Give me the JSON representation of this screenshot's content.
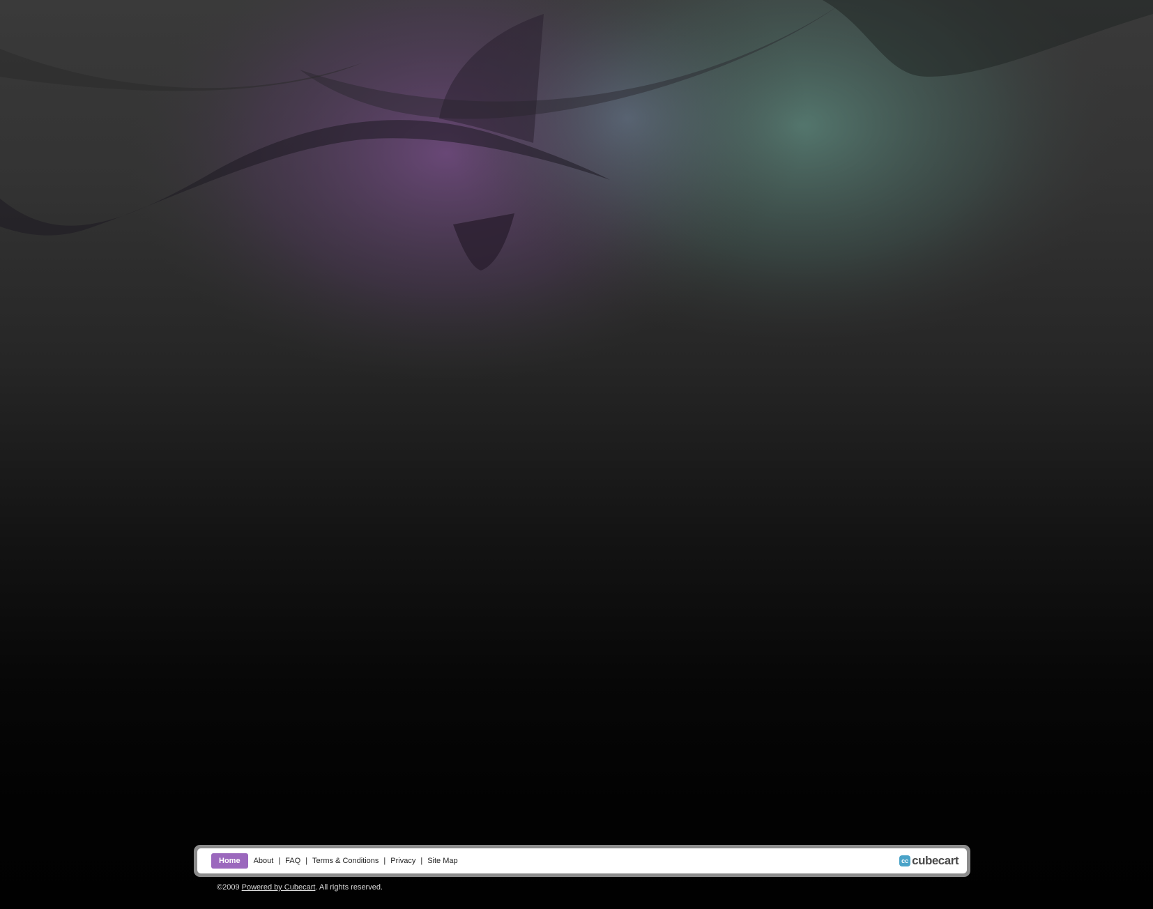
{
  "footer": {
    "nav": [
      {
        "label": "Home",
        "active": true
      },
      {
        "label": "About"
      },
      {
        "label": "FAQ"
      },
      {
        "label": "Terms & Conditions"
      },
      {
        "label": "Privacy"
      },
      {
        "label": "Site Map"
      }
    ],
    "separator": "|",
    "logo_mark": "cc",
    "logo_text": "cubecart"
  },
  "copyright": {
    "prefix": "©2009 ",
    "link_text": "Powered by Cubecart",
    "suffix": ". All rights reserved."
  },
  "colors": {
    "accent": "#9b68bd",
    "logo": "#4aa3c8",
    "background_top": "#3a3a3a",
    "background_bottom": "#010101"
  }
}
